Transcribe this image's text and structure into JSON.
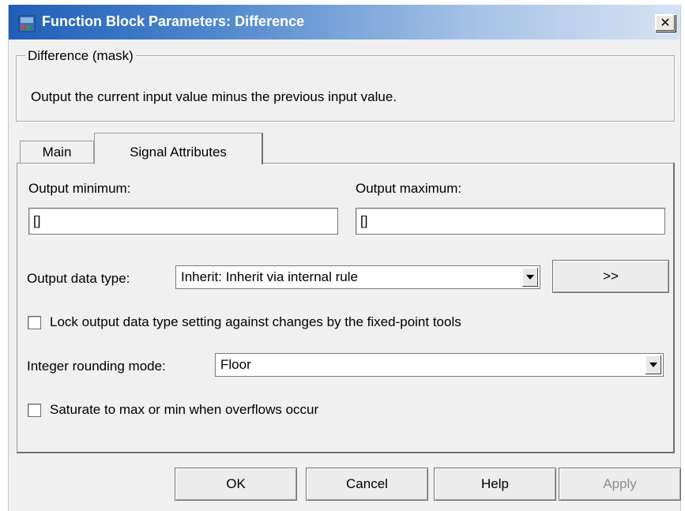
{
  "window": {
    "title": "Function Block Parameters: Difference",
    "close_label": "✕"
  },
  "mask": {
    "legend": "Difference (mask)",
    "description": "Output the current input value minus the previous input value."
  },
  "tabs": [
    {
      "label": "Main",
      "active": false
    },
    {
      "label": "Signal Attributes",
      "active": true
    }
  ],
  "fields": {
    "output_min_label": "Output minimum:",
    "output_min_value": "[]",
    "output_max_label": "Output maximum:",
    "output_max_value": "[]",
    "data_type_label": "Output data type:",
    "data_type_value": "Inherit: Inherit via internal rule",
    "data_type_assistant": ">>",
    "lock_label": "Lock output data type setting against changes by the fixed-point tools",
    "lock_checked": false,
    "rounding_label": "Integer rounding mode:",
    "rounding_value": "Floor",
    "saturate_label": "Saturate to max or min when overflows occur",
    "saturate_checked": false
  },
  "buttons": {
    "ok": "OK",
    "cancel": "Cancel",
    "help": "Help",
    "apply": "Apply"
  },
  "colors": {
    "titlebar_start": "#1f5fb8",
    "titlebar_end": "#d6e3f3",
    "dialog_bg": "#f0f0f0",
    "disabled_text": "#8d8d8d"
  },
  "icons": {
    "title": "simulink-block-icon",
    "close": "close-icon",
    "dropdown": "chevron-down-icon"
  }
}
